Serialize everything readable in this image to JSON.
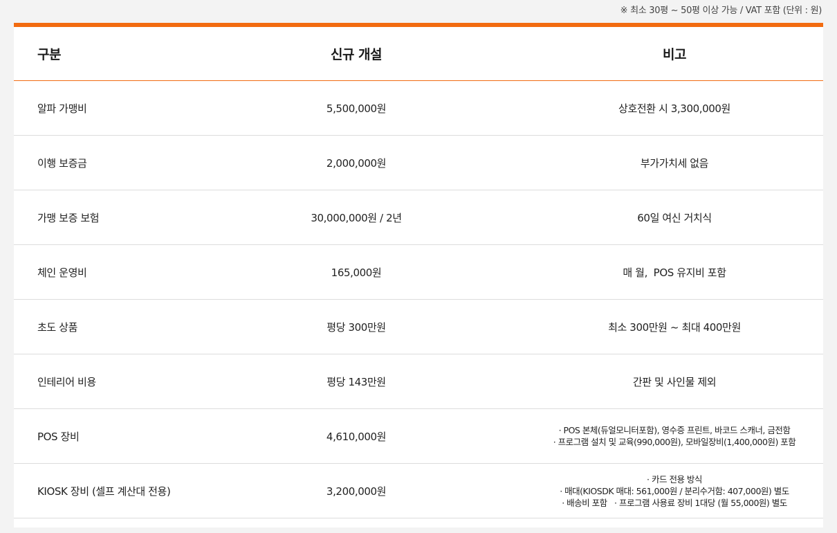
{
  "note": "※ 최소 30평 ~ 50평 이상 가능 / VAT 포함 (단위 : 원)",
  "accent_color": "#f26b10",
  "table": {
    "headers": [
      "구분",
      "신규 개설",
      "비고"
    ],
    "rows": [
      {
        "category": "알파 가맹비",
        "value": "5,500,000원",
        "remarks": [
          "상호전환 시 3,300,000원"
        ]
      },
      {
        "category": "이행 보증금",
        "value": "2,000,000원",
        "remarks": [
          "부가가치세 없음"
        ]
      },
      {
        "category": "가맹 보증 보험",
        "value": "30,000,000원 / 2년",
        "remarks": [
          "60일 여신 거치식"
        ]
      },
      {
        "category": "체인 운영비",
        "value": "165,000원",
        "remarks": [
          "매 월,  POS 유지비 포함"
        ]
      },
      {
        "category": "초도 상품",
        "value": "평당 300만원",
        "remarks": [
          "최소 300만원 ~ 최대 400만원"
        ]
      },
      {
        "category": "인테리어 비용",
        "value": "평당 143만원",
        "remarks": [
          "간판 및 사인물 제외"
        ]
      },
      {
        "category": "POS 장비",
        "value": "4,610,000원",
        "remarks": [
          "· POS 본체(듀얼모니터포함), 영수증 프린트, 바코드 스캐너, 금전함",
          "· 프로그램 설치 및 교육(990,000원), 모바일장비(1,400,000원) 포함"
        ]
      },
      {
        "category": "KIOSK 장비 (셀프 계산대 전용)",
        "value": "3,200,000원",
        "remarks": [
          "· 카드 전용 방식",
          "· 매대(KIOSDK 매대: 561,000원 / 분리수거함: 407,000원) 별도",
          "· 배송비 포함   · 프로그램 사용료 장비 1대당 (월 55,000원) 별도"
        ]
      }
    ]
  }
}
